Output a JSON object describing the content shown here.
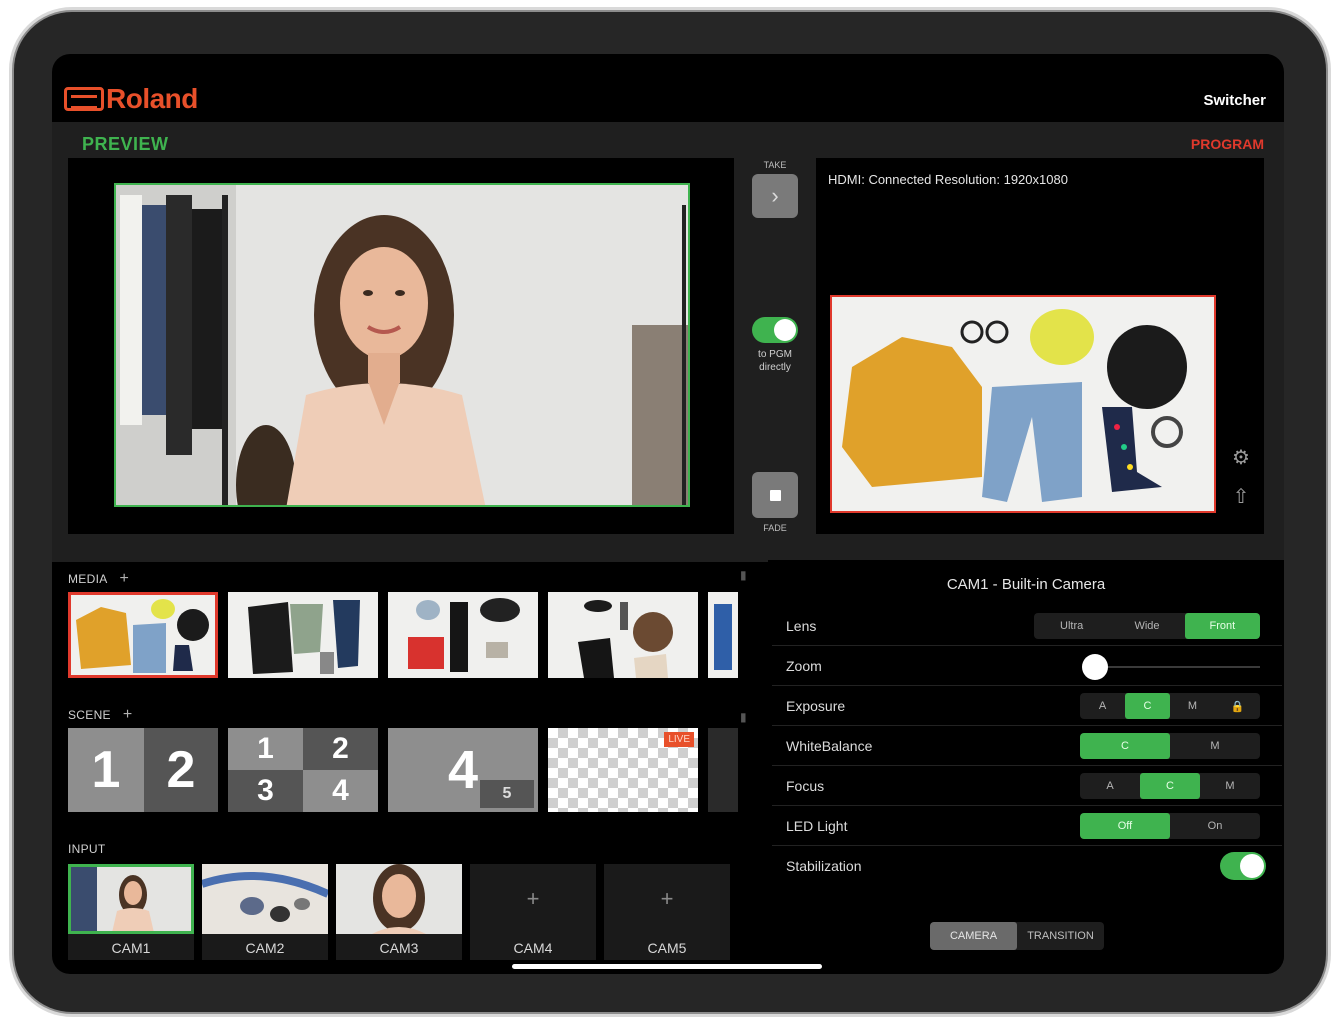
{
  "header": {
    "logo_text": "Roland",
    "title": "Switcher"
  },
  "preview": {
    "label": "PREVIEW"
  },
  "program": {
    "label": "PROGRAM",
    "hdmi_status": "HDMI:  Connected   Resolution:  1920x1080"
  },
  "controls": {
    "take_label": "TAKE",
    "fade_label": "FADE",
    "pgm_direct_label": "to PGM directly",
    "pgm_direct_on": true
  },
  "media": {
    "label": "MEDIA",
    "items": [
      "media-1",
      "media-2",
      "media-3",
      "media-4",
      "media-5"
    ],
    "selected_index": 0
  },
  "scene": {
    "label": "SCENE",
    "layouts": [
      {
        "digits": [
          "1",
          "2"
        ]
      },
      {
        "digits": [
          "1",
          "2",
          "3",
          "4"
        ]
      },
      {
        "digits": [
          "4",
          "5"
        ]
      },
      {
        "badge": "LIVE"
      }
    ]
  },
  "input": {
    "label": "INPUT",
    "items": [
      {
        "name": "CAM1",
        "active": true
      },
      {
        "name": "CAM2",
        "active": false
      },
      {
        "name": "CAM3",
        "active": false
      },
      {
        "name": "CAM4",
        "add": true
      },
      {
        "name": "CAM5",
        "add": true
      }
    ]
  },
  "camera_settings": {
    "title": "CAM1 - Built-in Camera",
    "lens": {
      "label": "Lens",
      "options": [
        "Ultra",
        "Wide",
        "Front"
      ],
      "selected": "Front"
    },
    "zoom": {
      "label": "Zoom",
      "value": 0
    },
    "exposure": {
      "label": "Exposure",
      "options": [
        "A",
        "C",
        "M"
      ],
      "selected": "C"
    },
    "white_balance": {
      "label": "WhiteBalance",
      "options": [
        "C",
        "M"
      ],
      "selected": "C"
    },
    "focus": {
      "label": "Focus",
      "options": [
        "A",
        "C",
        "M"
      ],
      "selected": "C"
    },
    "led_light": {
      "label": "LED Light",
      "options": [
        "Off",
        "On"
      ],
      "selected": "Off"
    },
    "stabilization": {
      "label": "Stabilization",
      "on": true
    }
  },
  "bottom_tabs": {
    "camera": "CAMERA",
    "transition": "TRANSITION",
    "selected": "CAMERA"
  },
  "colors": {
    "preview_green": "#3fb34f",
    "program_red": "#e0392c",
    "roland_orange": "#e8502a"
  }
}
